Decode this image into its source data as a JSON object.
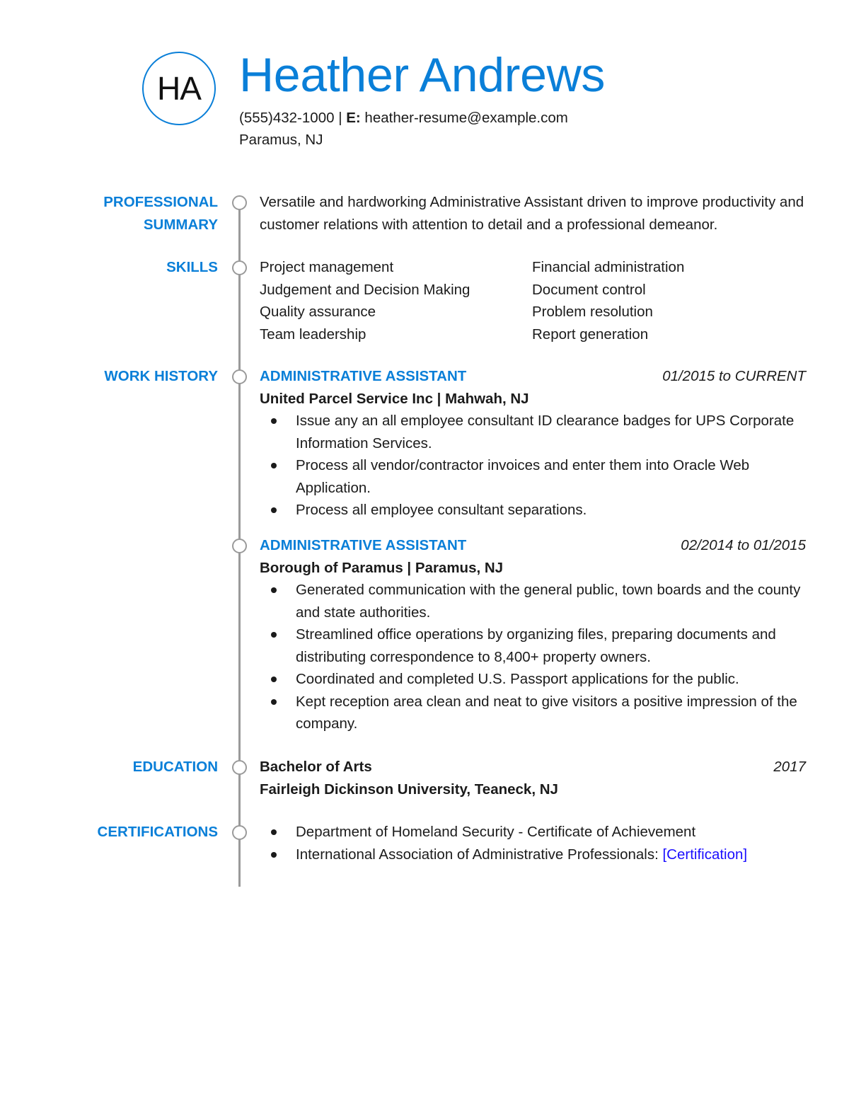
{
  "header": {
    "initials": "HA",
    "name": "Heather Andrews",
    "phone": "(555)432-1000",
    "separator": " | ",
    "email_label": "E:",
    "email": "heather-resume@example.com",
    "location": "Paramus, NJ"
  },
  "colors": {
    "accent": "#0a7fd8",
    "timeline": "#9a9a9a",
    "text": "#1b1b1b",
    "link": "#1a0dff"
  },
  "summary": {
    "label_line1": "PROFESSIONAL",
    "label_line2": "SUMMARY",
    "text": "Versatile and hardworking Administrative Assistant driven to improve productivity and customer relations with attention to detail and a professional demeanor."
  },
  "skills": {
    "label": "SKILLS",
    "items": [
      "Project management",
      "Financial administration",
      "Judgement and Decision Making",
      "Document control",
      "Quality assurance",
      "Problem resolution",
      "Team leadership",
      "Report generation"
    ]
  },
  "work_history": {
    "label": "WORK HISTORY",
    "jobs": [
      {
        "title": "ADMINISTRATIVE ASSISTANT",
        "dates": "01/2015 to CURRENT",
        "company": "United Parcel Service Inc | Mahwah, NJ",
        "bullets": [
          "Issue any an all employee consultant ID clearance badges for UPS Corporate Information Services.",
          "Process all vendor/contractor invoices and enter them into Oracle Web Application.",
          "Process all employee consultant separations."
        ]
      },
      {
        "title": "ADMINISTRATIVE ASSISTANT",
        "dates": "02/2014 to 01/2015",
        "company": "Borough of Paramus | Paramus, NJ",
        "bullets": [
          "Generated communication with the general public, town boards and the county and state authorities.",
          "Streamlined office operations by organizing files, preparing documents and distributing correspondence to 8,400+ property owners.",
          "Coordinated and completed U.S. Passport applications for the public.",
          "Kept reception area clean and neat to give visitors a positive impression of the company."
        ]
      }
    ]
  },
  "education": {
    "label": "EDUCATION",
    "degree": "Bachelor of Arts",
    "year": "2017",
    "school": "Fairleigh Dickinson University, Teaneck, NJ"
  },
  "certifications": {
    "label": "CERTIFICATIONS",
    "items": [
      {
        "text": "Department of Homeland Security - Certificate of Achievement",
        "link": ""
      },
      {
        "text": "International Association of Administrative Professionals: ",
        "link": "[Certification]"
      }
    ]
  }
}
